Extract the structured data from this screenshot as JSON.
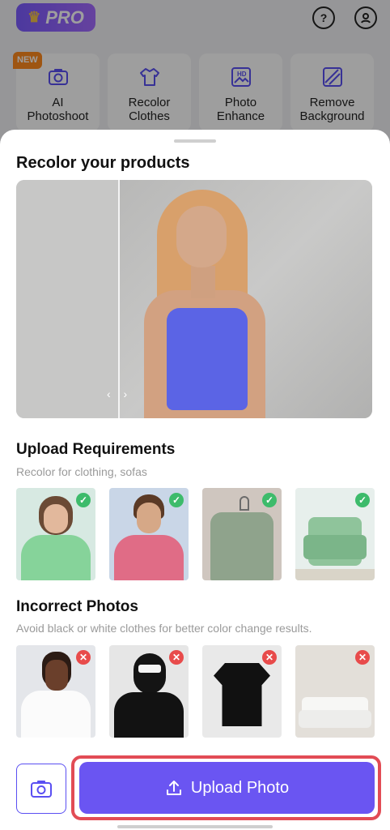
{
  "topbar": {
    "pro_label": "PRO"
  },
  "tools": [
    {
      "label": "AI\nPhotoshoot",
      "icon": "camera-icon",
      "badge": "NEW"
    },
    {
      "label": "Recolor\nClothes",
      "icon": "tshirt-icon"
    },
    {
      "label": "Photo\nEnhance",
      "icon": "hd-image-icon"
    },
    {
      "label": "Remove\nBackground",
      "icon": "erase-background-icon"
    }
  ],
  "sheet": {
    "title": "Recolor your products",
    "upload_requirements": {
      "title": "Upload Requirements",
      "subtitle": "Recolor for clothing, sofas"
    },
    "incorrect_photos": {
      "title": "Incorrect Photos",
      "subtitle": "Avoid black or white clothes for better color change results."
    }
  },
  "correct_examples": [
    {
      "name": "green-hoodie-person",
      "status": "ok"
    },
    {
      "name": "pink-sweater-person",
      "status": "ok"
    },
    {
      "name": "green-shirt-hanger",
      "status": "ok"
    },
    {
      "name": "green-armchair",
      "status": "ok"
    }
  ],
  "incorrect_examples": [
    {
      "name": "white-tshirt-person",
      "status": "bad"
    },
    {
      "name": "black-outfit-person",
      "status": "bad"
    },
    {
      "name": "black-tshirt",
      "status": "bad"
    },
    {
      "name": "white-sofa",
      "status": "bad"
    }
  ],
  "bottom": {
    "upload_label": "Upload Photo"
  },
  "colors": {
    "accent": "#6a55f2",
    "ok": "#3dbb6b",
    "bad": "#e84b4b",
    "outline": "#e24c55"
  }
}
